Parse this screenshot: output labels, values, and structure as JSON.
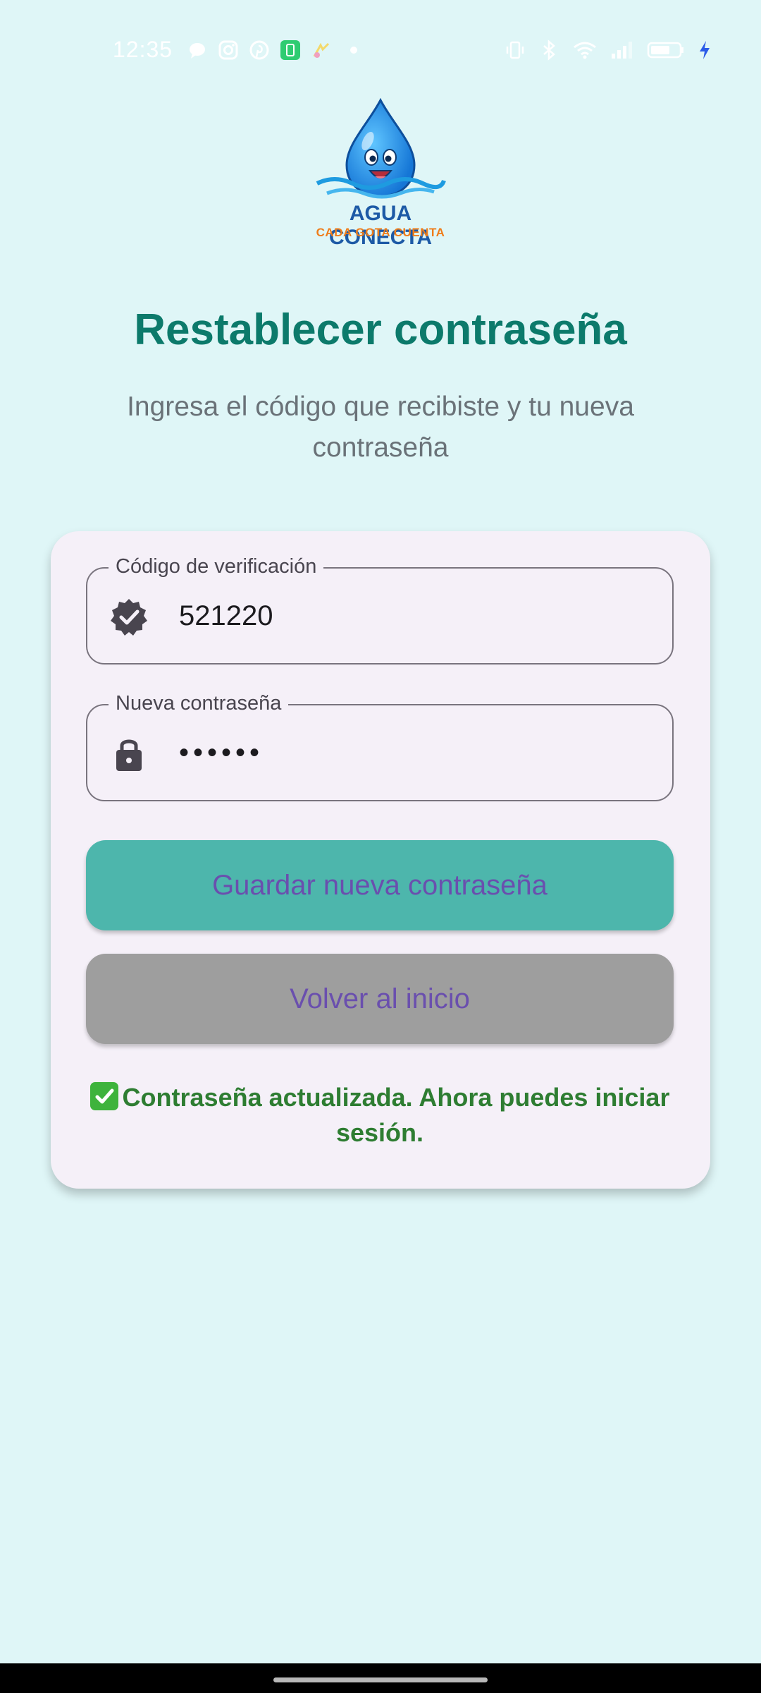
{
  "status_bar": {
    "time": "12:35",
    "left_icons": [
      "chat-bubble-icon",
      "instagram-icon",
      "pinterest-icon",
      "app-icon",
      "app-icon",
      "dot-icon"
    ],
    "right_icons": [
      "vibrate-icon",
      "bluetooth-icon",
      "wifi-icon",
      "signal-icon",
      "battery-icon",
      "charging-icon"
    ]
  },
  "logo": {
    "name": "AGUA CONECTA",
    "tagline": "CADA GOTA CUENTA"
  },
  "header": {
    "title": "Restablecer contraseña",
    "subtitle": "Ingresa el código que recibiste y tu nueva contraseña"
  },
  "form": {
    "code_field": {
      "label": "Código de verificación",
      "value": "521220",
      "icon": "verified-badge-icon"
    },
    "password_field": {
      "label": "Nueva contraseña",
      "value": "••••••",
      "icon": "lock-icon"
    },
    "save_label": "Guardar nueva contraseña",
    "back_label": "Volver al inicio",
    "success_message": "Contraseña actualizada. Ahora puedes iniciar sesión."
  },
  "colors": {
    "background": "#dff6f7",
    "title": "#0c7a6b",
    "save_button": "#4db6ac",
    "back_button": "#9e9e9e",
    "button_text": "#6a4fae",
    "success_text": "#2e7d32"
  }
}
